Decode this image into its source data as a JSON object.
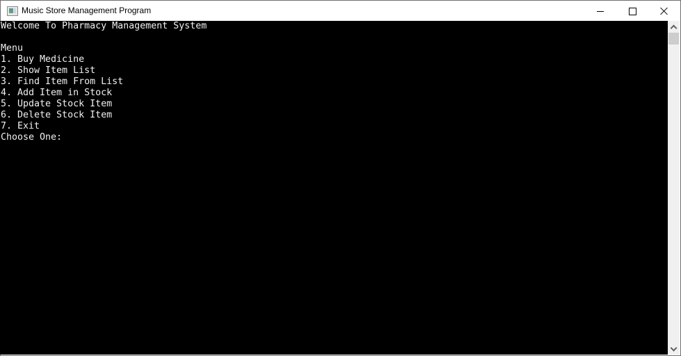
{
  "window": {
    "title": "Music Store Management Program",
    "controls": [
      "minimize",
      "maximize",
      "close"
    ]
  },
  "console": {
    "lines": [
      "Welcome To Pharmacy Management System",
      "",
      "Menu",
      "1. Buy Medicine",
      "2. Show Item List",
      "3. Find Item From List",
      "4. Add Item in Stock",
      "5. Update Stock Item",
      "6. Delete Stock Item",
      "7. Exit",
      "Choose One:"
    ]
  },
  "colors": {
    "console_bg": "#000000",
    "console_fg": "#f0f0f0",
    "scrollbar_track": "#f0f0f0",
    "scrollbar_thumb": "#cdcdcd"
  }
}
